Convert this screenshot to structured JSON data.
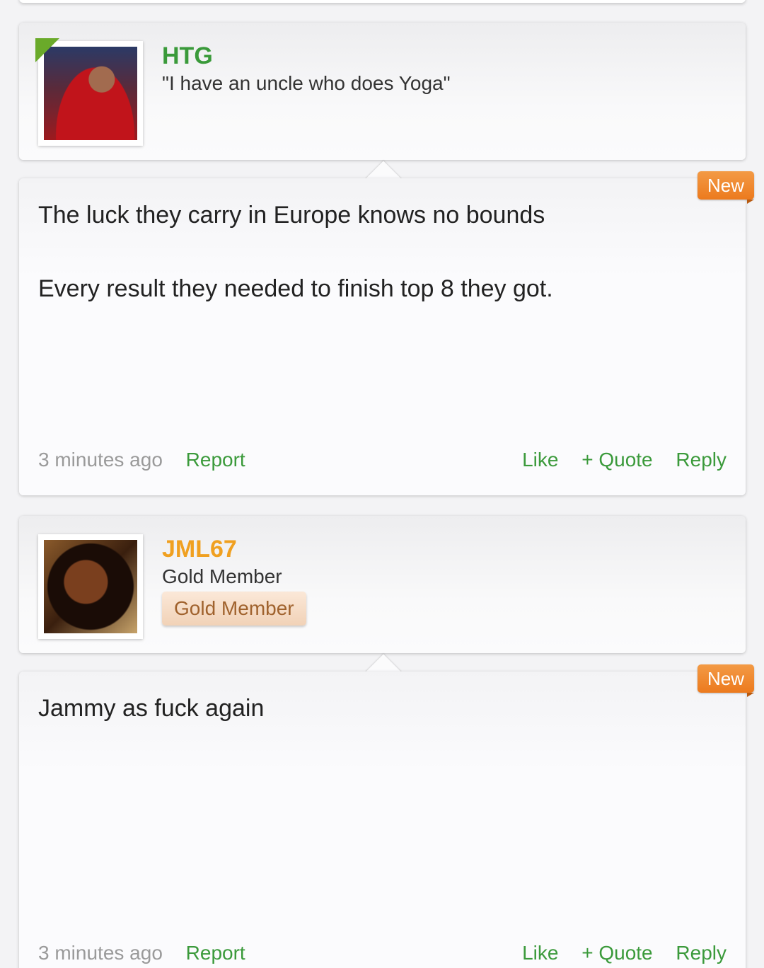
{
  "posts": [
    {
      "author": "HTG",
      "author_color": "#3a9a3a",
      "subtitle": "\"I have an uncle who does Yoga\"",
      "badge": "New",
      "paragraphs": [
        "The luck they carry in Europe knows no bounds",
        "Every result they needed to finish top 8 they got."
      ],
      "time": "3 minutes ago",
      "report": "Report",
      "like": "Like",
      "quote": "+ Quote",
      "reply": "Reply"
    },
    {
      "author": "JML67",
      "author_color": "#f0a020",
      "subtitle": "Gold Member",
      "rank_badge": "Gold Member",
      "badge": "New",
      "paragraphs": [
        "Jammy as fuck again"
      ],
      "time": "3 minutes ago",
      "report": "Report",
      "like": "Like",
      "quote": "+ Quote",
      "reply": "Reply"
    }
  ]
}
